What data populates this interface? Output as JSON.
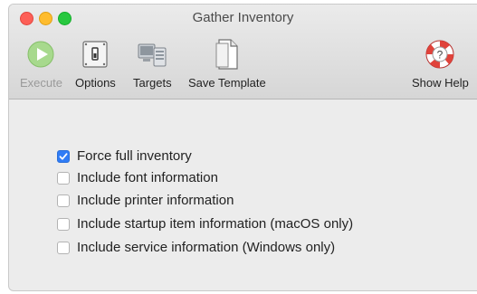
{
  "window": {
    "title": "Gather Inventory"
  },
  "toolbar": {
    "execute_label": "Execute",
    "options_label": "Options",
    "targets_label": "Targets",
    "save_template_label": "Save Template",
    "show_help_label": "Show Help"
  },
  "options": [
    {
      "label": "Force full inventory",
      "checked": true
    },
    {
      "label": "Include font information",
      "checked": false
    },
    {
      "label": "Include printer information",
      "checked": false
    },
    {
      "label": "Include startup item information (macOS only)",
      "checked": false
    },
    {
      "label": "Include service information (Windows only)",
      "checked": false
    }
  ],
  "colors": {
    "accent": "#2f7cf6",
    "execute": "#7dc35b"
  }
}
